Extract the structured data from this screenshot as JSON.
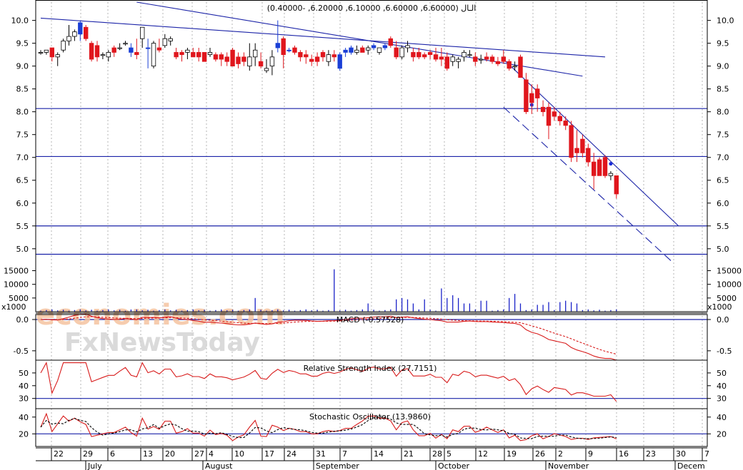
{
  "chart_data": {
    "type": "candlestick",
    "panels": {
      "price": {
        "title": "الـال (6.60000, 6.60000, 6.10000, 6.20000, -0.40000)",
        "ylim": [
          4.7,
          10.4
        ],
        "yticks": [
          "10.0",
          "9.5",
          "9.0",
          "8.5",
          "8.0",
          "7.5",
          "7.0",
          "6.5",
          "6.0",
          "5.5",
          "5.0"
        ],
        "ytick_values": [
          10.0,
          9.5,
          9.0,
          8.5,
          8.0,
          7.5,
          7.0,
          6.5,
          6.0,
          5.5,
          5.0
        ],
        "h_levels": [
          8.07,
          7.02,
          5.5,
          4.88
        ],
        "trendlines": [
          {
            "from": [
              0,
              10.05
            ],
            "to": [
              100,
              9.2
            ],
            "style": "solid"
          },
          {
            "from": [
              17,
              10.4
            ],
            "to": [
              96,
              8.78
            ],
            "style": "solid"
          },
          {
            "from": [
              82,
              9.15
            ],
            "to": [
              113,
              5.5
            ],
            "style": "solid"
          },
          {
            "from": [
              82,
              8.1
            ],
            "to": [
              112,
              4.7
            ],
            "style": "dashed"
          }
        ],
        "dots": [
          {
            "x": 87,
            "y": 8.15
          },
          {
            "x": 101,
            "y": 6.86
          }
        ]
      },
      "volume": {
        "ylim": [
          0,
          18000
        ],
        "yticks": [
          "15000",
          "10000",
          "5000"
        ],
        "ytick_values": [
          15000,
          10000,
          5000
        ],
        "unit_label": "x1000",
        "spike_bars": [
          [
            16,
            800
          ],
          [
            38,
            5000
          ],
          [
            52,
            15500
          ],
          [
            58,
            3000
          ],
          [
            63,
            4500
          ],
          [
            64,
            5000
          ],
          [
            65,
            4500
          ],
          [
            66,
            3000
          ],
          [
            68,
            4500
          ],
          [
            71,
            8500
          ],
          [
            72,
            5000
          ],
          [
            73,
            6000
          ],
          [
            74,
            5000
          ],
          [
            75,
            3000
          ],
          [
            76,
            3000
          ],
          [
            78,
            4000
          ],
          [
            79,
            4000
          ],
          [
            83,
            5000
          ],
          [
            84,
            6500
          ],
          [
            85,
            3000
          ],
          [
            88,
            2500
          ],
          [
            89,
            2500
          ],
          [
            90,
            3500
          ],
          [
            92,
            3500
          ],
          [
            93,
            4000
          ],
          [
            94,
            3500
          ],
          [
            95,
            3000
          ]
        ]
      },
      "macd": {
        "title": "MACD (-0.57528)",
        "ylim": [
          -0.65,
          0.08
        ],
        "yticks": [
          "0.0",
          "-0.5"
        ],
        "ytick_values": [
          0.0,
          -0.5
        ]
      },
      "rsi": {
        "title": "Relative Strength Index (27.7151)",
        "ylim": [
          22,
          60
        ],
        "yticks": [
          "50",
          "40",
          "30"
        ],
        "ytick_values": [
          50,
          40,
          30
        ],
        "h_levels": [
          30
        ]
      },
      "stoch": {
        "title": "Stochastic Oscillator (13.9860)",
        "ylim": [
          5,
          50
        ],
        "yticks": [
          "40",
          "20"
        ],
        "ytick_values": [
          40,
          20
        ],
        "h_levels": [
          20
        ]
      }
    },
    "x_day_labels": [
      "22",
      "29",
      "6",
      "13",
      "20",
      "27",
      "4",
      "10",
      "17",
      "24",
      "31",
      "7",
      "14",
      "21",
      "28",
      "5",
      "12",
      "19",
      "26",
      "2",
      "9",
      "16",
      "23",
      "30",
      "7"
    ],
    "x_month_labels": [
      "July",
      "August",
      "September",
      "October",
      "November",
      "Decem"
    ],
    "candles": [
      [
        9.3,
        9.35,
        9.25,
        9.3
      ],
      [
        9.3,
        9.35,
        9.25,
        9.35
      ],
      [
        9.4,
        9.4,
        9.1,
        9.2
      ],
      [
        9.2,
        9.3,
        9.0,
        9.25
      ],
      [
        9.35,
        9.6,
        9.3,
        9.55
      ],
      [
        9.55,
        9.9,
        9.45,
        9.65
      ],
      [
        9.65,
        9.8,
        9.55,
        9.75
      ],
      [
        9.95,
        10.0,
        9.55,
        9.7
      ],
      [
        9.85,
        9.9,
        9.55,
        9.6
      ],
      [
        9.5,
        9.55,
        9.1,
        9.15
      ],
      [
        9.45,
        9.55,
        9.1,
        9.2
      ],
      [
        9.25,
        9.3,
        9.15,
        9.25
      ],
      [
        9.2,
        9.35,
        9.1,
        9.3
      ],
      [
        9.4,
        9.45,
        9.2,
        9.3
      ],
      [
        9.4,
        9.5,
        9.35,
        9.4
      ],
      [
        9.5,
        9.55,
        9.45,
        9.5
      ],
      [
        9.4,
        9.5,
        9.2,
        9.3
      ],
      [
        9.3,
        9.6,
        9.15,
        9.25
      ],
      [
        9.6,
        9.85,
        9.4,
        9.85
      ],
      [
        9.4,
        9.6,
        8.95,
        9.4
      ],
      [
        9.0,
        9.55,
        8.95,
        9.5
      ],
      [
        9.4,
        9.6,
        9.3,
        9.35
      ],
      [
        9.45,
        9.7,
        9.4,
        9.6
      ],
      [
        9.55,
        9.65,
        9.45,
        9.6
      ],
      [
        9.3,
        9.4,
        9.15,
        9.2
      ],
      [
        9.3,
        9.35,
        9.1,
        9.25
      ],
      [
        9.3,
        9.4,
        9.15,
        9.35
      ],
      [
        9.3,
        9.4,
        9.2,
        9.2
      ],
      [
        9.3,
        9.4,
        9.1,
        9.2
      ],
      [
        9.3,
        9.3,
        9.1,
        9.1
      ],
      [
        9.25,
        9.4,
        9.2,
        9.3
      ],
      [
        9.25,
        9.3,
        9.1,
        9.15
      ],
      [
        9.25,
        9.3,
        9.0,
        9.15
      ],
      [
        9.2,
        9.3,
        9.0,
        9.1
      ],
      [
        9.35,
        9.4,
        9.0,
        9.0
      ],
      [
        9.2,
        9.3,
        8.95,
        9.05
      ],
      [
        9.2,
        9.3,
        9.0,
        9.1
      ],
      [
        9.0,
        9.5,
        8.9,
        9.2
      ],
      [
        9.2,
        9.5,
        9.0,
        9.35
      ],
      [
        9.1,
        9.3,
        8.95,
        9.0
      ],
      [
        8.9,
        9.15,
        8.85,
        8.95
      ],
      [
        9.0,
        9.35,
        8.8,
        9.2
      ],
      [
        9.5,
        10.0,
        9.3,
        9.4
      ],
      [
        9.6,
        9.65,
        8.95,
        9.25
      ],
      [
        9.35,
        9.4,
        9.3,
        9.35
      ],
      [
        9.4,
        9.45,
        9.25,
        9.3
      ],
      [
        9.3,
        9.35,
        9.1,
        9.2
      ],
      [
        9.25,
        9.35,
        9.05,
        9.2
      ],
      [
        9.15,
        9.25,
        9.0,
        9.1
      ],
      [
        9.2,
        9.3,
        9.0,
        9.1
      ],
      [
        9.3,
        9.35,
        9.1,
        9.2
      ],
      [
        9.1,
        9.35,
        9.0,
        9.25
      ],
      [
        9.25,
        9.35,
        9.1,
        9.2
      ],
      [
        8.95,
        9.3,
        8.9,
        9.25
      ],
      [
        9.3,
        9.4,
        9.2,
        9.35
      ],
      [
        9.3,
        9.45,
        9.25,
        9.4
      ],
      [
        9.3,
        9.45,
        9.25,
        9.35
      ],
      [
        9.4,
        9.45,
        9.3,
        9.3
      ],
      [
        9.35,
        9.45,
        9.25,
        9.4
      ],
      [
        9.4,
        9.5,
        9.35,
        9.45
      ],
      [
        9.3,
        9.4,
        9.25,
        9.4
      ],
      [
        9.45,
        9.5,
        9.35,
        9.4
      ],
      [
        9.6,
        9.65,
        9.4,
        9.45
      ],
      [
        9.4,
        9.55,
        9.15,
        9.2
      ],
      [
        9.2,
        9.45,
        9.15,
        9.4
      ],
      [
        9.4,
        9.55,
        9.3,
        9.45
      ],
      [
        9.3,
        9.4,
        9.1,
        9.2
      ],
      [
        9.3,
        9.4,
        9.15,
        9.2
      ],
      [
        9.25,
        9.3,
        9.15,
        9.2
      ],
      [
        9.3,
        9.35,
        9.15,
        9.25
      ],
      [
        9.25,
        9.4,
        9.1,
        9.15
      ],
      [
        9.2,
        9.4,
        9.0,
        9.15
      ],
      [
        9.2,
        9.3,
        8.9,
        8.95
      ],
      [
        9.1,
        9.25,
        9.0,
        9.2
      ],
      [
        9.1,
        9.2,
        8.95,
        9.15
      ],
      [
        9.2,
        9.35,
        9.1,
        9.3
      ],
      [
        9.25,
        9.35,
        9.2,
        9.25
      ],
      [
        9.2,
        9.3,
        9.0,
        9.1
      ],
      [
        9.15,
        9.25,
        9.05,
        9.15
      ],
      [
        9.2,
        9.3,
        9.1,
        9.15
      ],
      [
        9.2,
        9.25,
        9.05,
        9.1
      ],
      [
        9.1,
        9.2,
        9.0,
        9.05
      ],
      [
        9.2,
        9.35,
        9.05,
        9.1
      ],
      [
        9.1,
        9.15,
        8.9,
        8.95
      ],
      [
        9.0,
        9.1,
        8.9,
        9.0
      ],
      [
        9.2,
        9.25,
        8.75,
        8.75
      ],
      [
        8.7,
        8.85,
        7.95,
        8.0
      ],
      [
        8.4,
        8.6,
        7.95,
        8.2
      ],
      [
        8.5,
        8.6,
        8.0,
        8.3
      ],
      [
        8.1,
        8.25,
        7.9,
        8.0
      ],
      [
        8.1,
        8.2,
        7.4,
        7.7
      ],
      [
        8.0,
        8.1,
        7.8,
        7.9
      ],
      [
        7.9,
        8.0,
        7.7,
        7.8
      ],
      [
        7.8,
        7.9,
        7.6,
        7.7
      ],
      [
        7.7,
        7.8,
        6.9,
        7.0
      ],
      [
        7.2,
        7.6,
        6.9,
        7.1
      ],
      [
        7.4,
        7.5,
        7.0,
        7.1
      ],
      [
        7.2,
        7.3,
        6.8,
        6.9
      ],
      [
        6.9,
        7.1,
        6.3,
        6.6
      ],
      [
        6.95,
        7.0,
        6.6,
        6.6
      ],
      [
        7.0,
        7.05,
        6.55,
        6.6
      ],
      [
        6.6,
        6.7,
        6.5,
        6.65
      ],
      [
        6.6,
        6.6,
        6.1,
        6.2
      ]
    ]
  },
  "watermark": {
    "line1": "economies.com",
    "line2": "FxNewsToday"
  },
  "colors": {
    "frame": "#000000",
    "grid": "#b4b4b4",
    "level": "#1a22a8",
    "trend": "#1c24a8",
    "up": "#ffffff",
    "down": "#e0161d",
    "blue_candle": "#1a3fd6",
    "indicator": "#d81b1b",
    "signal": "#000000",
    "watermark_orange": "#f5c4a0",
    "watermark_gray": "#d8d8d8"
  }
}
